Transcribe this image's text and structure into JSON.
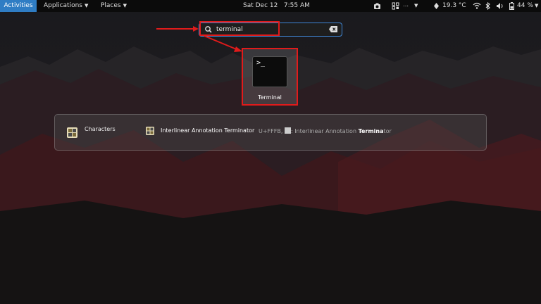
{
  "topbar": {
    "activities": "Activities",
    "applications": "Applications",
    "places": "Places",
    "clock": "Sat Dec 12   7:55 AM",
    "weather": "19.3 °C",
    "battery": "44 %",
    "icons": [
      "camera-icon",
      "network-grid-icon",
      "dropdown-arrow-icon",
      "weather-icon",
      "wifi-icon",
      "bluetooth-icon",
      "volume-icon",
      "battery-icon"
    ]
  },
  "search": {
    "value": "terminal"
  },
  "app_results": [
    {
      "label": "Terminal",
      "icon": "terminal-icon"
    }
  ],
  "provider": {
    "name": "Characters",
    "result_title": "Interlinear Annotation Terminator",
    "result_code": "U+FFFB,",
    "result_desc_prefix": ": Interlinear Annotation ",
    "result_desc_highlight": "Termina",
    "result_desc_suffix": "tor"
  },
  "colors": {
    "activities_bg": "#2f7dc4",
    "annotation_red": "#e01b1b",
    "search_border": "#3f86d6"
  }
}
